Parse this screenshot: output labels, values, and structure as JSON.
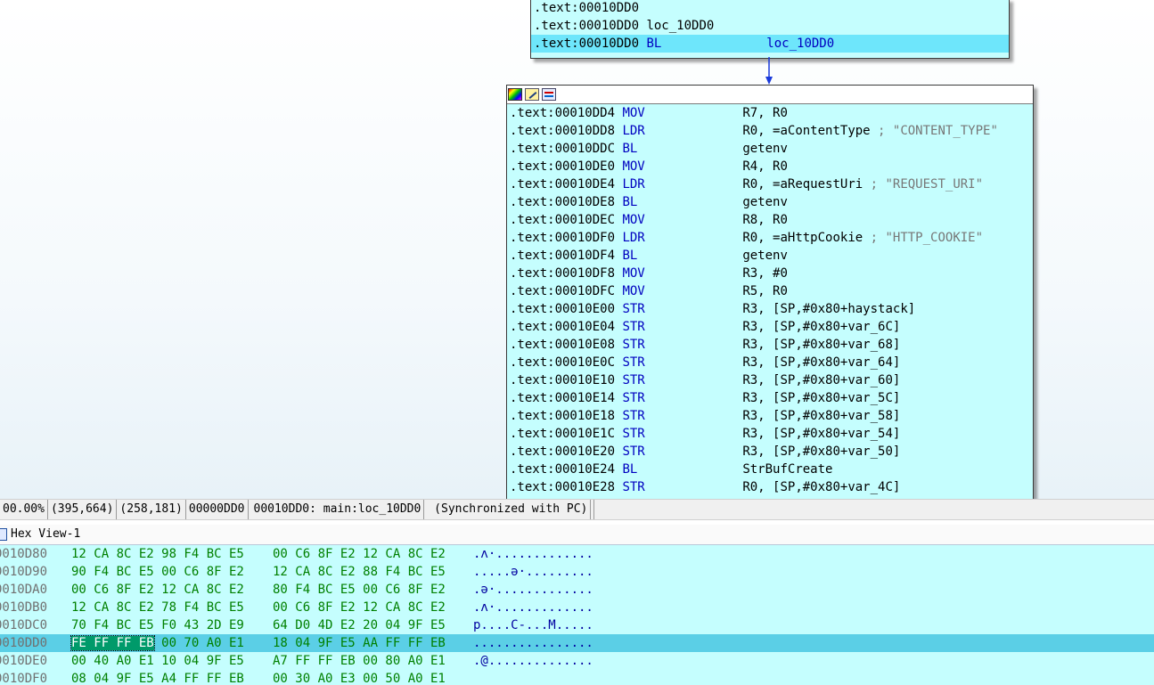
{
  "top_node": {
    "lines": [
      {
        "addr": ".text:00010DD0",
        "rest": ""
      },
      {
        "addr": ".text:00010DD0",
        "rest": " loc_10DD0"
      },
      {
        "addr": ".text:00010DD0",
        "rest": " BL              loc_10DD0"
      }
    ]
  },
  "main_node": {
    "header_icons": [
      "color-icon",
      "edit-icon",
      "graph-icon"
    ],
    "lines": [
      {
        "addr": ".text:00010DD4",
        "mnem": " MOV             ",
        "ops": "R7, R0",
        "comment": ""
      },
      {
        "addr": ".text:00010DD8",
        "mnem": " LDR             ",
        "ops": "R0, =aContentType",
        "comment": " ; \"CONTENT_TYPE\""
      },
      {
        "addr": ".text:00010DDC",
        "mnem": " BL              ",
        "ops": "getenv",
        "comment": ""
      },
      {
        "addr": ".text:00010DE0",
        "mnem": " MOV             ",
        "ops": "R4, R0",
        "comment": ""
      },
      {
        "addr": ".text:00010DE4",
        "mnem": " LDR             ",
        "ops": "R0, =aRequestUri",
        "comment": " ; \"REQUEST_URI\""
      },
      {
        "addr": ".text:00010DE8",
        "mnem": " BL              ",
        "ops": "getenv",
        "comment": ""
      },
      {
        "addr": ".text:00010DEC",
        "mnem": " MOV             ",
        "ops": "R8, R0",
        "comment": ""
      },
      {
        "addr": ".text:00010DF0",
        "mnem": " LDR             ",
        "ops": "R0, =aHttpCookie",
        "comment": " ; \"HTTP_COOKIE\""
      },
      {
        "addr": ".text:00010DF4",
        "mnem": " BL              ",
        "ops": "getenv",
        "comment": ""
      },
      {
        "addr": ".text:00010DF8",
        "mnem": " MOV             ",
        "ops": "R3, #0",
        "comment": ""
      },
      {
        "addr": ".text:00010DFC",
        "mnem": " MOV             ",
        "ops": "R5, R0",
        "comment": ""
      },
      {
        "addr": ".text:00010E00",
        "mnem": " STR             ",
        "ops": "R3, [SP,#0x80+haystack]",
        "comment": ""
      },
      {
        "addr": ".text:00010E04",
        "mnem": " STR             ",
        "ops": "R3, [SP,#0x80+var_6C]",
        "comment": ""
      },
      {
        "addr": ".text:00010E08",
        "mnem": " STR             ",
        "ops": "R3, [SP,#0x80+var_68]",
        "comment": ""
      },
      {
        "addr": ".text:00010E0C",
        "mnem": " STR             ",
        "ops": "R3, [SP,#0x80+var_64]",
        "comment": ""
      },
      {
        "addr": ".text:00010E10",
        "mnem": " STR             ",
        "ops": "R3, [SP,#0x80+var_60]",
        "comment": ""
      },
      {
        "addr": ".text:00010E14",
        "mnem": " STR             ",
        "ops": "R3, [SP,#0x80+var_5C]",
        "comment": ""
      },
      {
        "addr": ".text:00010E18",
        "mnem": " STR             ",
        "ops": "R3, [SP,#0x80+var_58]",
        "comment": ""
      },
      {
        "addr": ".text:00010E1C",
        "mnem": " STR             ",
        "ops": "R3, [SP,#0x80+var_54]",
        "comment": ""
      },
      {
        "addr": ".text:00010E20",
        "mnem": " STR             ",
        "ops": "R3, [SP,#0x80+var_50]",
        "comment": ""
      },
      {
        "addr": ".text:00010E24",
        "mnem": " BL              ",
        "ops": "StrBufCreate",
        "comment": ""
      },
      {
        "addr": ".text:00010E28",
        "mnem": " STR             ",
        "ops": "R0, [SP,#0x80+var_4C]",
        "comment": ""
      }
    ]
  },
  "status_bar": {
    "zoom": "00.00%",
    "coords1": "(395,664)",
    "coords2": "(258,181)",
    "offset": "00000DD0",
    "location": "00010DD0: main:loc_10DD0",
    "sync": "(Synchronized with PC)"
  },
  "hex_view": {
    "title": "Hex View-1",
    "rows": [
      {
        "addr": "0010D80",
        "b1": "12 CA 8C E2 98 F4 BC E5",
        "b2": "00 C6 8F E2 12 CA 8C E2",
        "ascii": ".ʌ·.............",
        "hl": false
      },
      {
        "addr": "0010D90",
        "b1": "90 F4 BC E5 00 C6 8F E2",
        "b2": "12 CA 8C E2 88 F4 BC E5",
        "ascii": ".....ə·.........",
        "hl": false
      },
      {
        "addr": "0010DA0",
        "b1": "00 C6 8F E2 12 CA 8C E2",
        "b2": "80 F4 BC E5 00 C6 8F E2",
        "ascii": ".ə·.............",
        "hl": false
      },
      {
        "addr": "0010DB0",
        "b1": "12 CA 8C E2 78 F4 BC E5",
        "b2": "00 C6 8F E2 12 CA 8C E2",
        "ascii": ".ʌ·.............",
        "hl": false
      },
      {
        "addr": "0010DC0",
        "b1": "70 F4 BC E5 F0 43 2D E9",
        "b2": "64 D0 4D E2 20 04 9F E5",
        "ascii": "p....C-...M.....",
        "hl": false
      },
      {
        "addr": "0010DD0",
        "sel": "FE FF FF EB",
        "b1rest": " 00 70 A0 E1",
        "b2": "18 04 9F E5 AA FF FF EB",
        "ascii": "................",
        "hl": true
      },
      {
        "addr": "0010DE0",
        "b1": "00 40 A0 E1 10 04 9F E5",
        "b2": "A7 FF FF EB 00 80 A0 E1",
        "ascii": ".@..............",
        "hl": false
      },
      {
        "addr": "0010DF0",
        "b1": "08 04 9F E5 A4 FF FF EB",
        "b2": "00 30 A0 E3 00 50 A0 E1",
        "ascii": "",
        "hl": false
      }
    ]
  },
  "colors": {
    "node_bg": "#c5fefe",
    "highlight": "#6ee6fb",
    "mnemonic": "#0000c0",
    "hex_bytes": "#008000"
  }
}
